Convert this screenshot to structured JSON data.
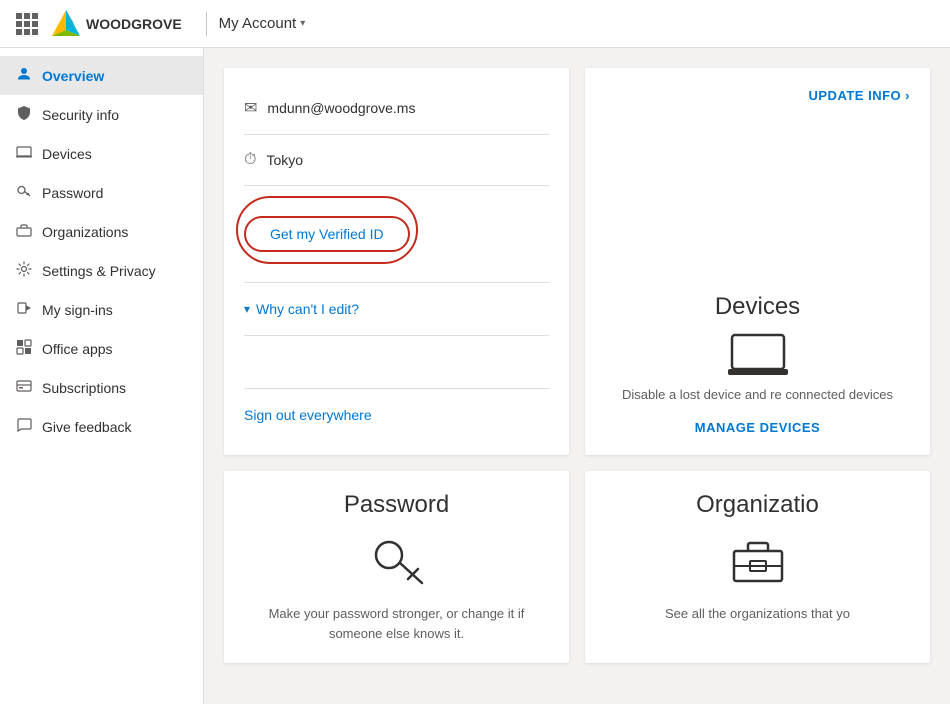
{
  "header": {
    "app_name": "My Account",
    "logo_text": "WOODGROVE",
    "chevron": "▾"
  },
  "sidebar": {
    "items": [
      {
        "id": "overview",
        "label": "Overview",
        "icon": "person",
        "active": true
      },
      {
        "id": "security-info",
        "label": "Security info",
        "icon": "shield"
      },
      {
        "id": "devices",
        "label": "Devices",
        "icon": "laptop"
      },
      {
        "id": "password",
        "label": "Password",
        "icon": "key"
      },
      {
        "id": "organizations",
        "label": "Organizations",
        "icon": "briefcase"
      },
      {
        "id": "settings-privacy",
        "label": "Settings & Privacy",
        "icon": "settings"
      },
      {
        "id": "my-sign-ins",
        "label": "My sign-ins",
        "icon": "signin"
      },
      {
        "id": "office-apps",
        "label": "Office apps",
        "icon": "office"
      },
      {
        "id": "subscriptions",
        "label": "Subscriptions",
        "icon": "subscription"
      },
      {
        "id": "give-feedback",
        "label": "Give feedback",
        "icon": "feedback"
      }
    ]
  },
  "profile_card": {
    "email": "mdunn@woodgrove.ms",
    "location": "Tokyo",
    "verified_id_label": "Get my Verified ID",
    "why_cant_edit": "Why can't I edit?",
    "sign_out_label": "Sign out everywhere"
  },
  "update_info_card": {
    "update_link": "UPDATE INFO",
    "chevron": "›",
    "devices_title": "Devices",
    "devices_description": "Disable a lost device and re connected devices",
    "manage_link": "MANAGE DEVICES"
  },
  "password_card": {
    "title": "Password",
    "description": "Make your password stronger, or change it if someone else knows it."
  },
  "org_card": {
    "title": "Organizatio",
    "description": "See all the organizations that yo"
  },
  "colors": {
    "accent": "#0078d4",
    "text_primary": "#323130",
    "text_secondary": "#605e5c",
    "border": "#e1dfdd",
    "red": "#c42b1c"
  }
}
